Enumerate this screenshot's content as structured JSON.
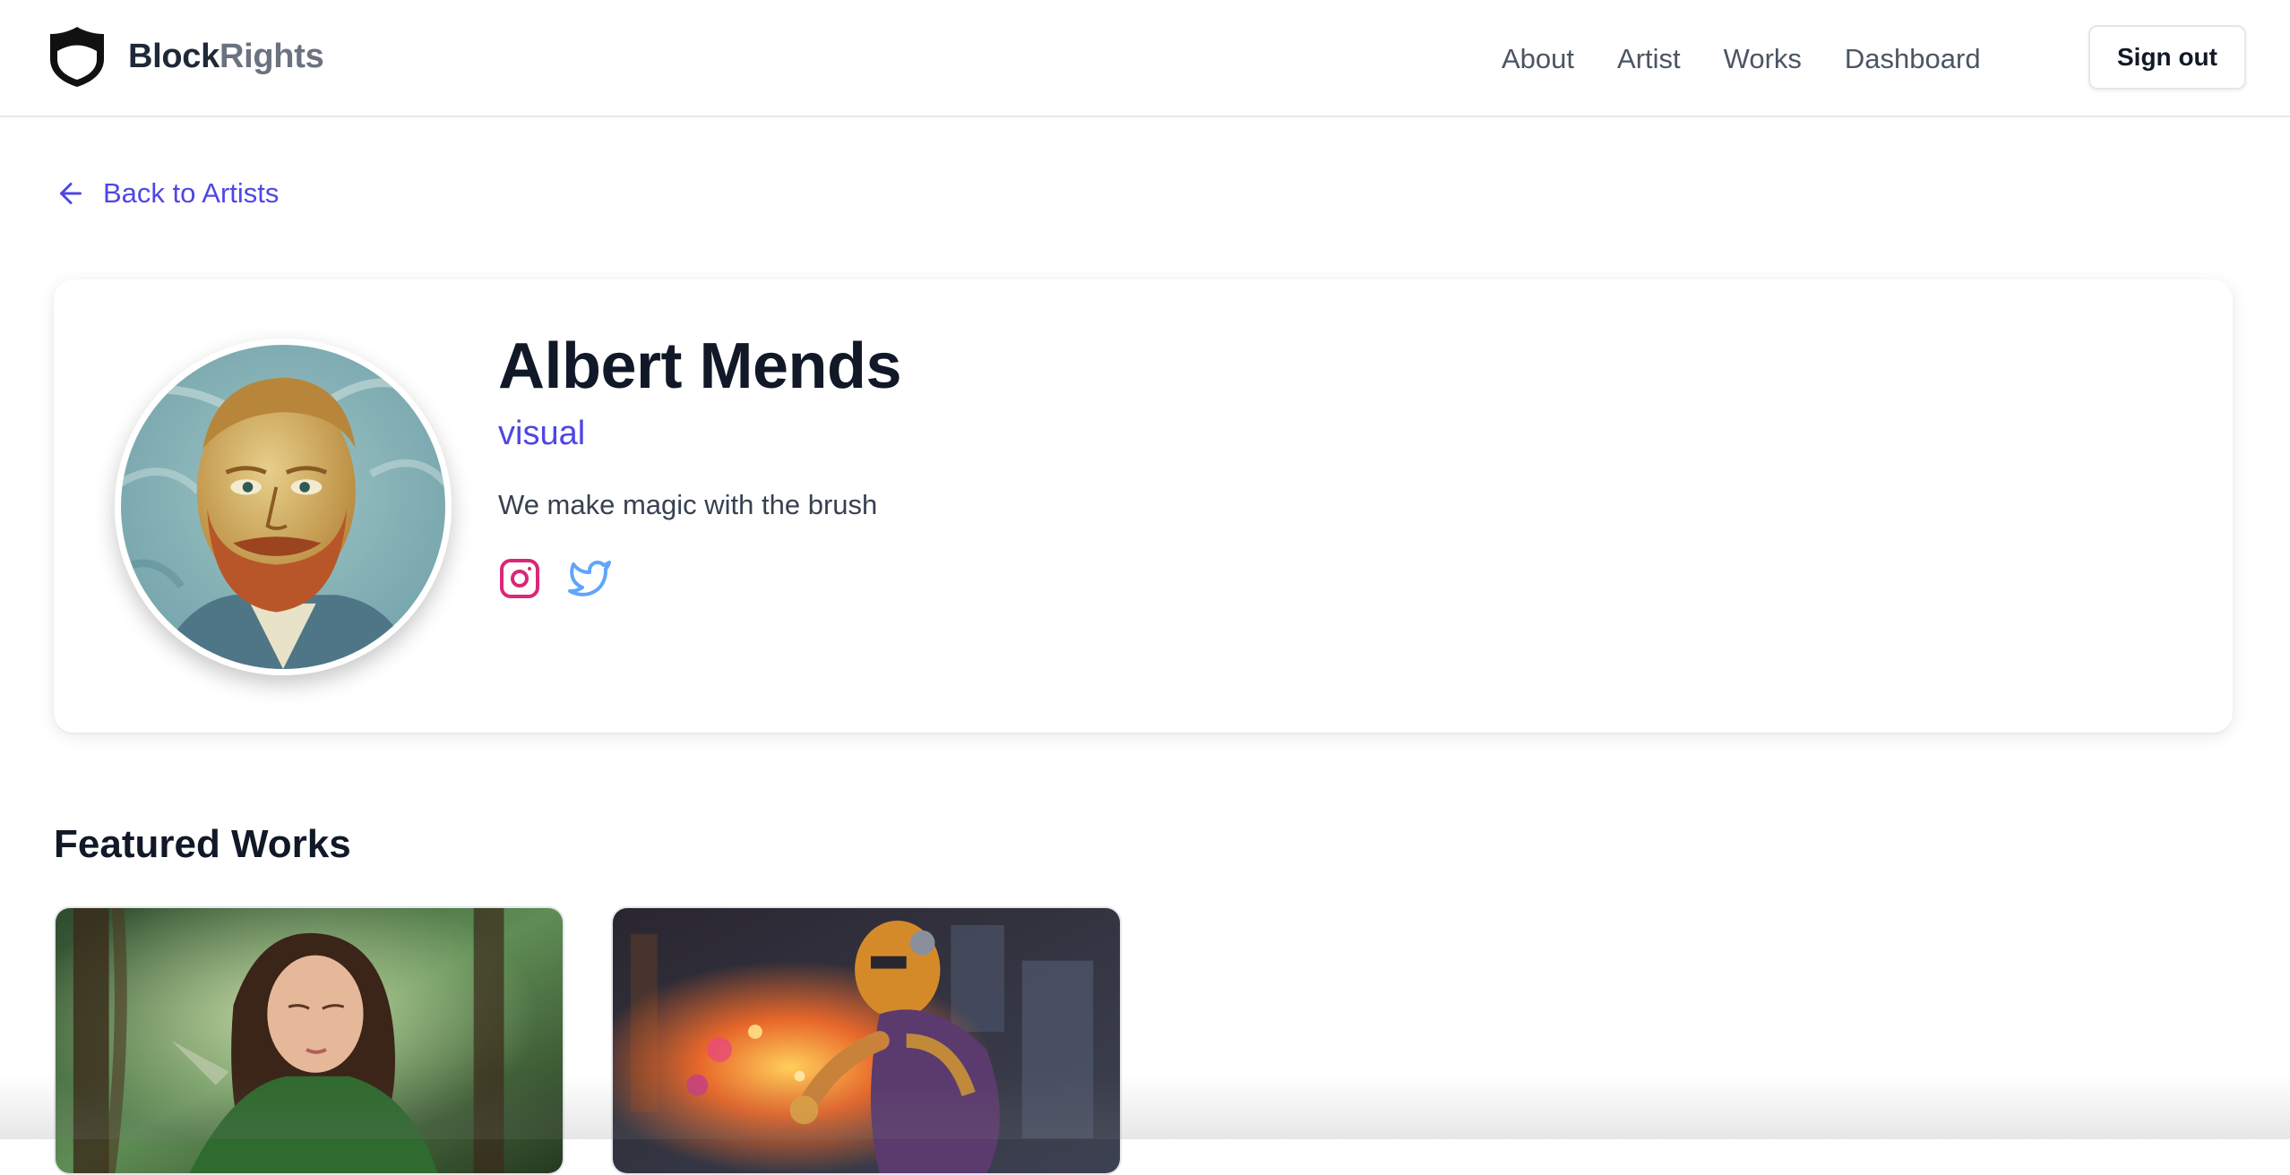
{
  "brand": {
    "name_part1": "Block",
    "name_part2": "Rights",
    "logo_icon": "shield-icon"
  },
  "nav": {
    "links": [
      {
        "label": "About"
      },
      {
        "label": "Artist"
      },
      {
        "label": "Works"
      },
      {
        "label": "Dashboard"
      }
    ],
    "signout_label": "Sign out"
  },
  "back_link": {
    "label": "Back to Artists",
    "icon": "arrow-left-icon"
  },
  "profile": {
    "name": "Albert Mends",
    "category": "visual",
    "bio": "We make magic with the brush",
    "socials": [
      {
        "name": "instagram-icon",
        "color": "#db2777"
      },
      {
        "name": "twitter-icon",
        "color": "#60a5fa"
      }
    ]
  },
  "featured": {
    "title": "Featured Works",
    "works": [
      {
        "image": "forest elf girl artwork"
      },
      {
        "image": "robot painter artwork"
      }
    ]
  },
  "colors": {
    "accent": "#4f46e5",
    "text_dark": "#111827",
    "text_muted": "#4b5563",
    "border": "#e5e7eb"
  }
}
